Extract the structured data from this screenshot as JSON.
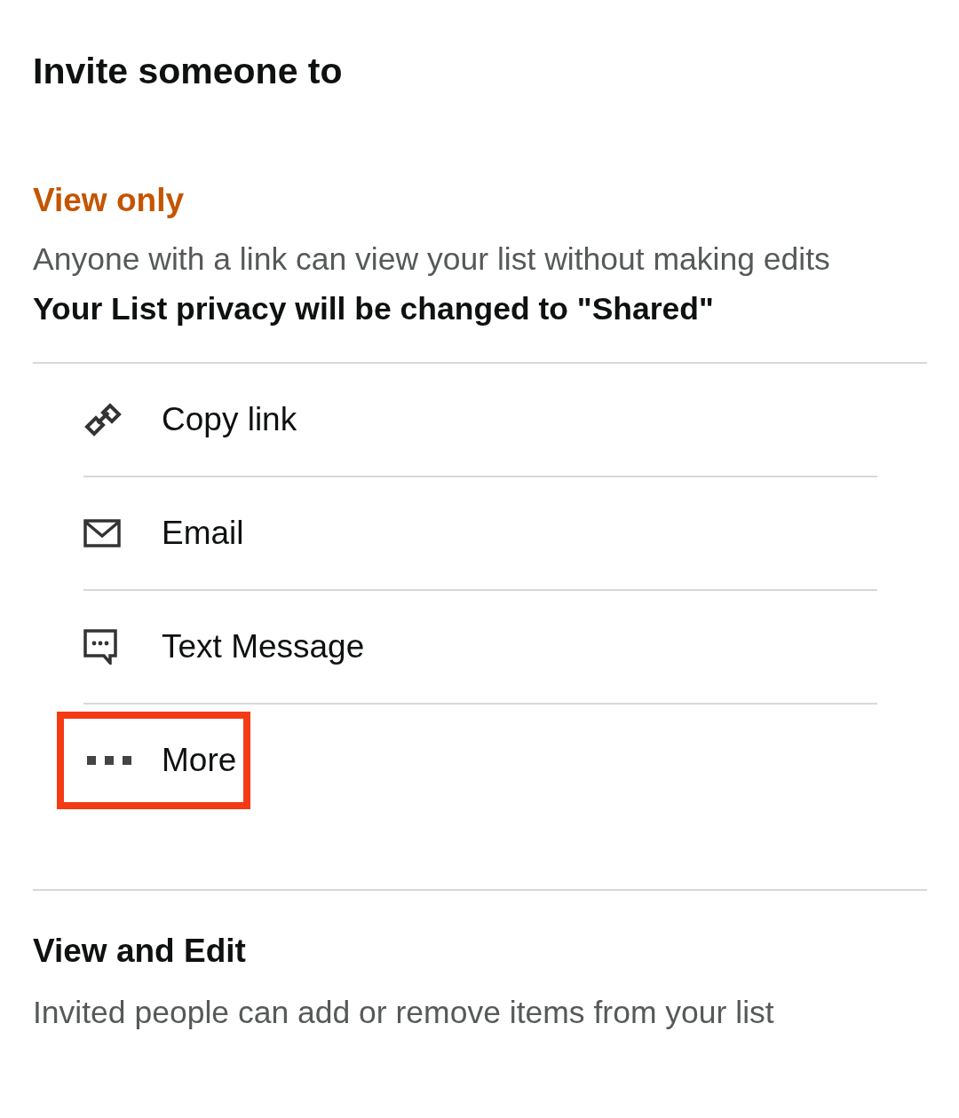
{
  "title": "Invite someone to",
  "view_only": {
    "heading": "View only",
    "description": "Anyone with a link can view your list without making edits",
    "notice": "Your List privacy will be changed to \"Shared\""
  },
  "share_options": [
    {
      "kind": "link",
      "label": "Copy link",
      "highlighted": false
    },
    {
      "kind": "email",
      "label": "Email",
      "highlighted": false
    },
    {
      "kind": "message",
      "label": "Text Message",
      "highlighted": false
    },
    {
      "kind": "more",
      "label": "More",
      "highlighted": true
    }
  ],
  "view_and_edit": {
    "heading": "View and Edit",
    "description": "Invited people can add or remove items from your list"
  }
}
